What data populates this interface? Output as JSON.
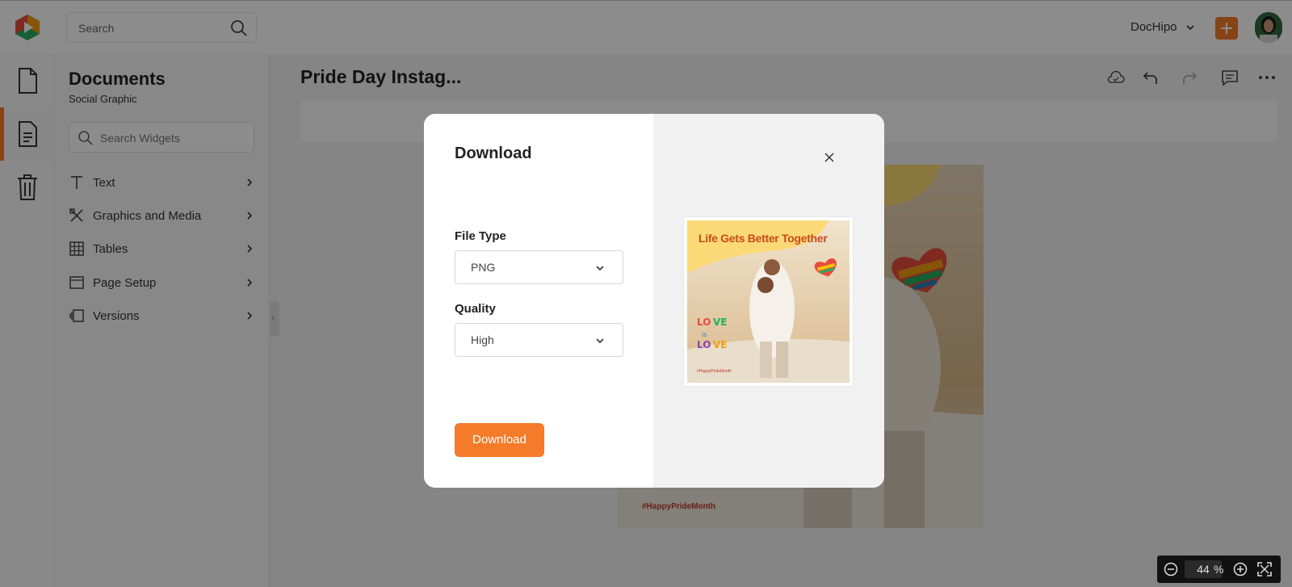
{
  "header": {
    "search_placeholder": "Search",
    "brand_label": "DocHipo",
    "accent_color": "#f47b2a"
  },
  "rail": {
    "items": [
      {
        "icon": "document-icon"
      },
      {
        "icon": "page-icon",
        "active": true
      },
      {
        "icon": "trash-icon"
      }
    ]
  },
  "sidebar": {
    "title": "Documents",
    "subtitle": "Social Graphic",
    "search_placeholder": "Search Widgets",
    "items": [
      {
        "label": "Text",
        "icon": "text-icon"
      },
      {
        "label": "Graphics and Media",
        "icon": "graphics-icon"
      },
      {
        "label": "Tables",
        "icon": "table-icon"
      },
      {
        "label": "Page Setup",
        "icon": "page-setup-icon"
      },
      {
        "label": "Versions",
        "icon": "versions-icon"
      }
    ]
  },
  "main": {
    "doc_title": "Pride Day Instag...",
    "canvas_hashtag": "#HappyPrideMonth"
  },
  "zoom": {
    "value": "44",
    "unit": "%"
  },
  "modal": {
    "title": "Download",
    "file_type_label": "File Type",
    "file_type_value": "PNG",
    "quality_label": "Quality",
    "quality_value": "High",
    "download_button": "Download",
    "preview": {
      "headline": "Life Gets Better Together",
      "hashtag": "#HappyPrideMonth"
    }
  }
}
